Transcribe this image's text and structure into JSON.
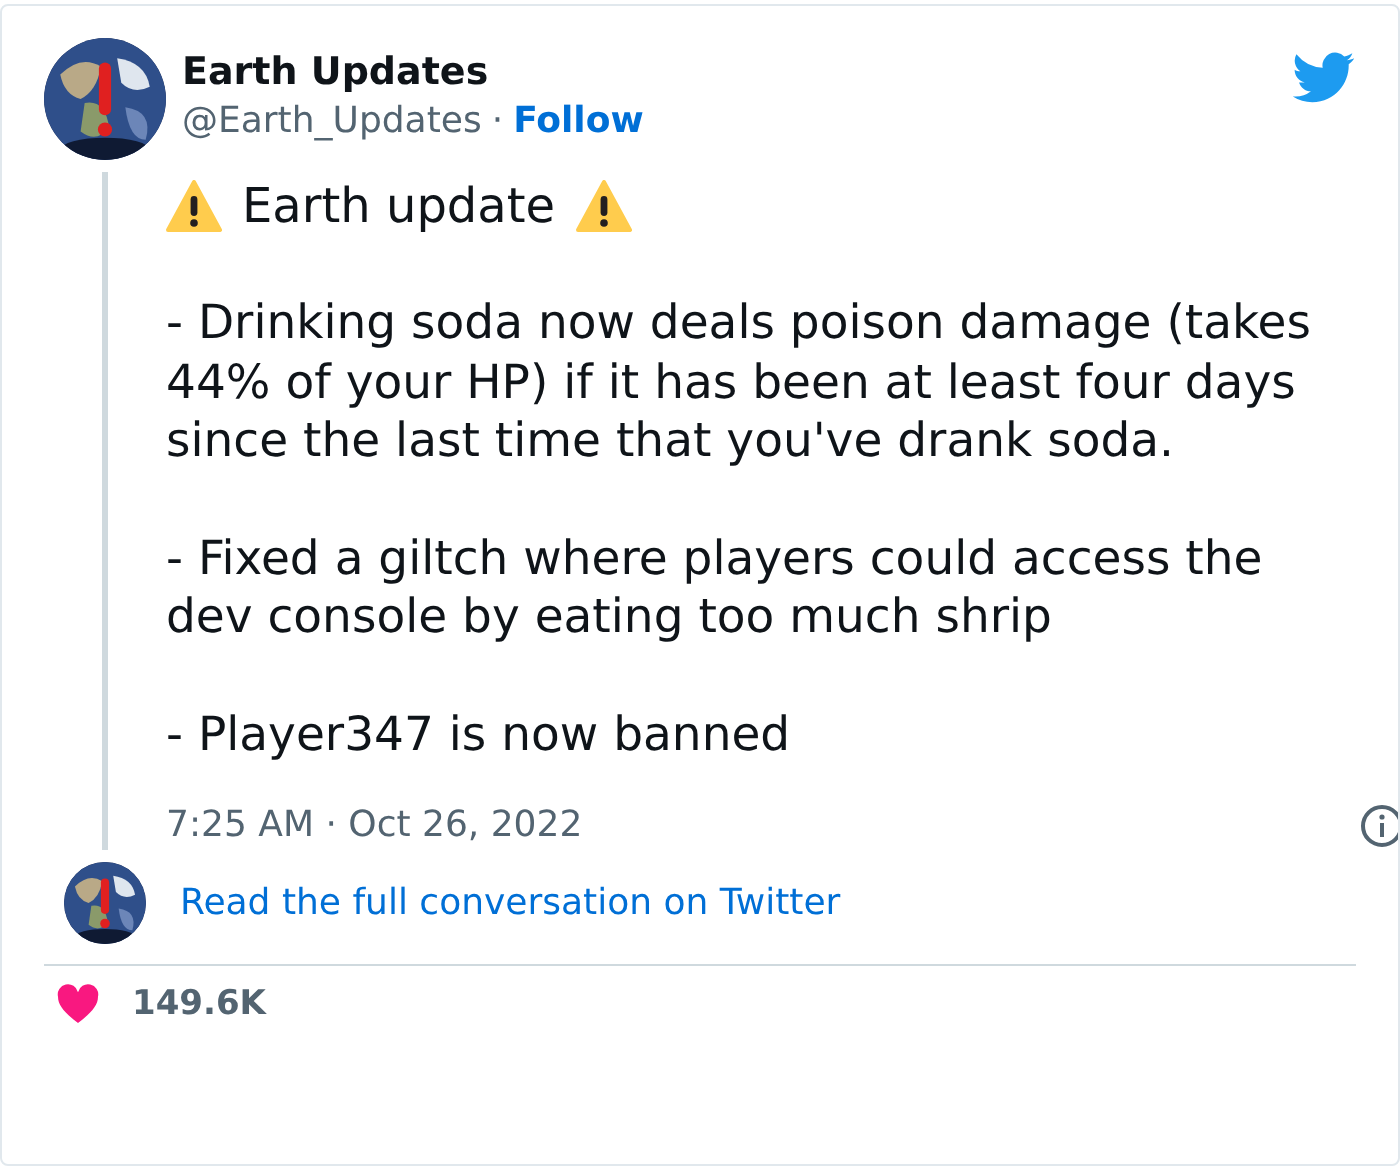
{
  "author": {
    "name": "Earth Updates",
    "handle": "@Earth_Updates",
    "separator": "·",
    "follow": "Follow"
  },
  "tweet": {
    "heading": "Earth update",
    "paragraphs": [
      "- Drinking soda now deals poison damage (takes 44% of your HP) if it has been at least four days since the last time that you've drank soda.",
      "- Fixed a giltch where players could access the dev console by eating too much shrip",
      "- Player347 is now banned"
    ],
    "timestamp": "7:25 AM · Oct 26, 2022"
  },
  "conversation_link": "Read the full conversation on Twitter",
  "likes": "149.6K"
}
